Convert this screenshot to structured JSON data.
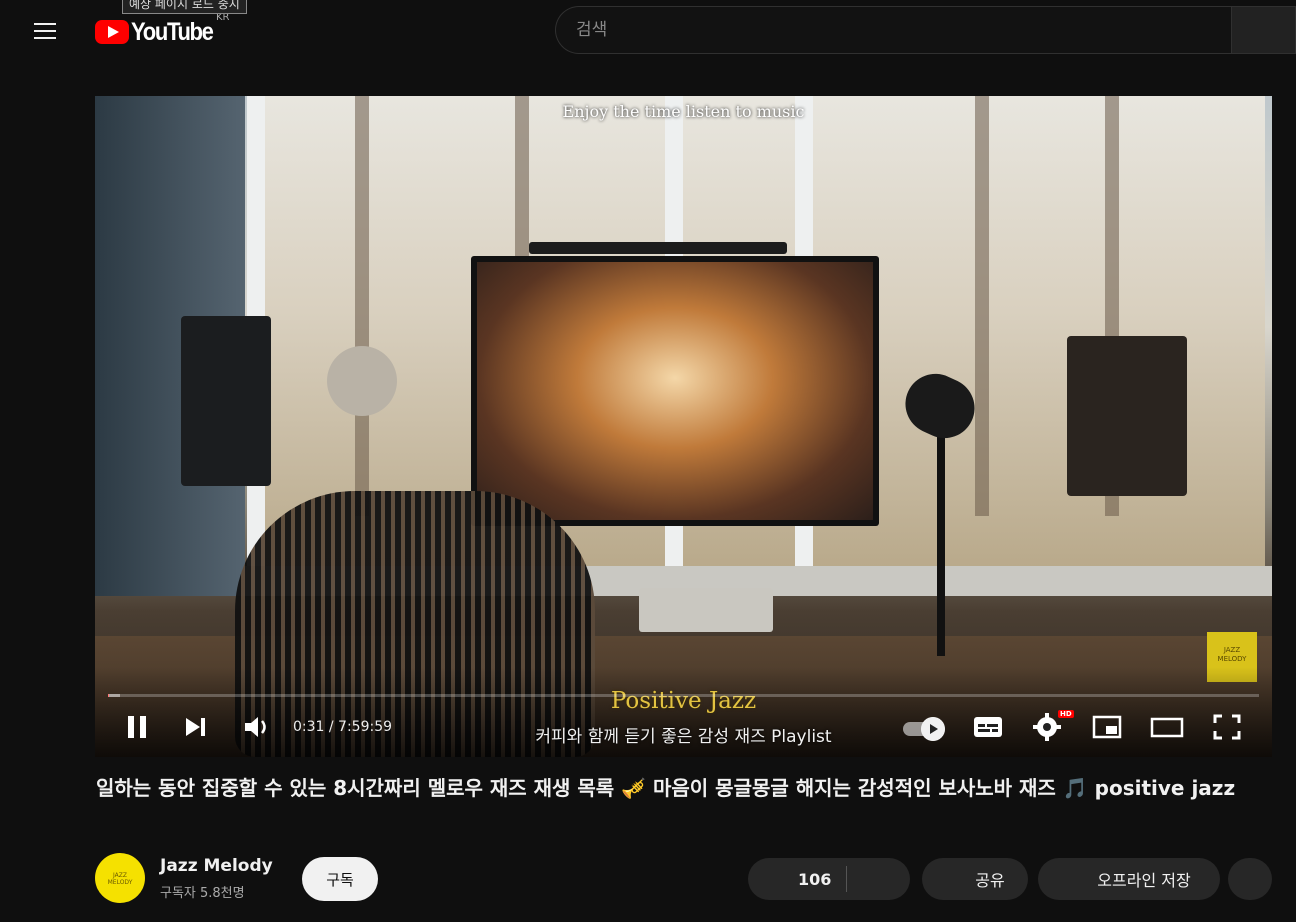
{
  "header": {
    "logo_text": "YouTube",
    "country": "KR",
    "tooltip": "예상 페이지 로드 중지",
    "search_placeholder": "검색"
  },
  "player": {
    "overlay_top": "Enjoy the time listen to music",
    "overlay_title": "Positive Jazz",
    "overlay_subtitle": "커피와 함께 듣기 좋은 감성 재즈 Playlist",
    "watermark": "JAZZ MELODY",
    "time_display": "0:31 / 7:59:59",
    "progress_fraction": 0.001,
    "hd_badge": "HD",
    "icons": [
      "pause-icon",
      "next-icon",
      "volume-icon",
      "autoplay-toggle",
      "subtitles-icon",
      "settings-icon",
      "miniplayer-icon",
      "theater-icon",
      "fullscreen-icon"
    ]
  },
  "video": {
    "title": "일하는 동안 집중할 수 있는 8시간짜리 멜로우 재즈 재생 목록 🎺 마음이 몽글몽글 해지는 감성적인 보사노바 재즈 🎵 positive jazz"
  },
  "channel": {
    "name": "Jazz Melody",
    "subscribers": "구독자 5.8천명",
    "avatar_text": "JAZZ MELODY",
    "subscribe_label": "구독"
  },
  "actions": {
    "like_count": "106",
    "share_label": "공유",
    "download_label": "오프라인 저장"
  },
  "colors": {
    "background": "#0f0f0f",
    "accent": "#ff0000",
    "pill": "#272727"
  }
}
